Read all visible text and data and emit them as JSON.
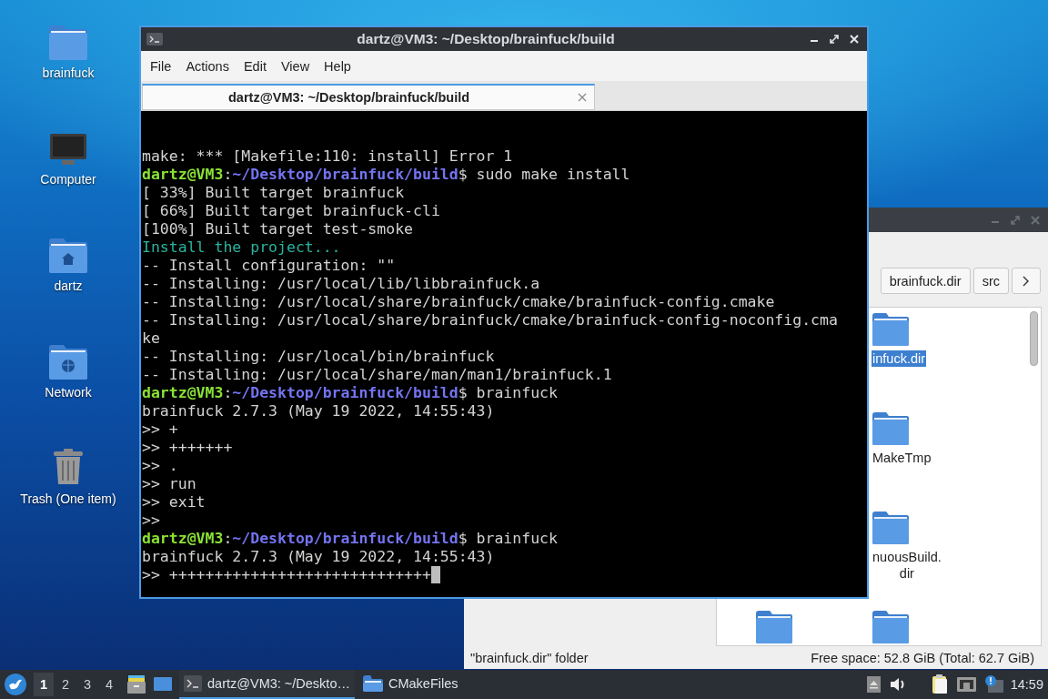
{
  "desktop_icons": [
    {
      "label": "brainfuck",
      "kind": "folder"
    },
    {
      "label": "Computer",
      "kind": "computer"
    },
    {
      "label": "dartz",
      "kind": "home"
    },
    {
      "label": "Network",
      "kind": "network"
    },
    {
      "label": "Trash (One item)",
      "kind": "trash"
    }
  ],
  "file_manager": {
    "breadcrumbs": [
      "brainfuck.dir",
      "src"
    ],
    "files": [
      {
        "label": "infuck.dir",
        "selected": true
      },
      {
        "label": "MakeTmp",
        "selected": false
      },
      {
        "label": "nuousBuild.\ndir",
        "selected": false
      },
      {
        "selected": false
      },
      {
        "selected": false
      }
    ],
    "status_bar": {
      "selection": "\"brainfuck.dir\" folder",
      "free_space": "Free space: 52.8 GiB (Total: 62.7 GiB)"
    }
  },
  "terminal": {
    "title": "dartz@VM3: ~/Desktop/brainfuck/build",
    "menu": [
      "File",
      "Actions",
      "Edit",
      "View",
      "Help"
    ],
    "tabs": [
      {
        "label": "dartz@VM3: ~/Desktop/brainfuck/build",
        "selected": true
      }
    ],
    "cursor": true,
    "lines": [
      [
        {
          "kind": "plain",
          "text": "make: *** [Makefile:110: install] Error 1"
        }
      ],
      [
        {
          "kind": "user",
          "text": "dartz@VM3"
        },
        {
          "kind": "plain",
          "text": ":"
        },
        {
          "kind": "path",
          "text": "~/Desktop/brainfuck/build"
        },
        {
          "kind": "plain",
          "text": "$ sudo make install"
        }
      ],
      [
        {
          "kind": "plain",
          "text": "[ 33%] Built target brainfuck"
        }
      ],
      [
        {
          "kind": "plain",
          "text": "[ 66%] Built target brainfuck-cli"
        }
      ],
      [
        {
          "kind": "plain",
          "text": "[100%] Built target test-smoke"
        }
      ],
      [
        {
          "kind": "info",
          "text": "Install the project..."
        }
      ],
      [
        {
          "kind": "plain",
          "text": "-- Install configuration: \"\""
        }
      ],
      [
        {
          "kind": "plain",
          "text": "-- Installing: /usr/local/lib/libbrainfuck.a"
        }
      ],
      [
        {
          "kind": "plain",
          "text": "-- Installing: /usr/local/share/brainfuck/cmake/brainfuck-config.cmake"
        }
      ],
      [
        {
          "kind": "plain",
          "text": "-- Installing: /usr/local/share/brainfuck/cmake/brainfuck-config-noconfig.cma"
        }
      ],
      [
        {
          "kind": "plain",
          "text": "ke"
        }
      ],
      [
        {
          "kind": "plain",
          "text": "-- Installing: /usr/local/bin/brainfuck"
        }
      ],
      [
        {
          "kind": "plain",
          "text": "-- Installing: /usr/local/share/man/man1/brainfuck.1"
        }
      ],
      [
        {
          "kind": "user",
          "text": "dartz@VM3"
        },
        {
          "kind": "plain",
          "text": ":"
        },
        {
          "kind": "path",
          "text": "~/Desktop/brainfuck/build"
        },
        {
          "kind": "plain",
          "text": "$ brainfuck"
        }
      ],
      [
        {
          "kind": "plain",
          "text": "brainfuck 2.7.3 (May 19 2022, 14:55:43)"
        }
      ],
      [
        {
          "kind": "plain",
          "text": ">> +"
        }
      ],
      [
        {
          "kind": "plain",
          "text": ">> +++++++"
        }
      ],
      [
        {
          "kind": "plain",
          "text": ">> ."
        }
      ],
      [
        {
          "kind": "plain",
          "text": ">> run"
        }
      ],
      [
        {
          "kind": "plain",
          "text": ">> exit"
        }
      ],
      [
        {
          "kind": "plain",
          "text": ">>"
        }
      ],
      [
        {
          "kind": "user",
          "text": "dartz@VM3"
        },
        {
          "kind": "plain",
          "text": ":"
        },
        {
          "kind": "path",
          "text": "~/Desktop/brainfuck/build"
        },
        {
          "kind": "plain",
          "text": "$ brainfuck"
        }
      ],
      [
        {
          "kind": "plain",
          "text": "brainfuck 2.7.3 (May 19 2022, 14:55:43)"
        }
      ],
      [
        {
          "kind": "plain",
          "text": ">> +++++++++++++++++++++++++++++"
        }
      ]
    ]
  },
  "taskbar": {
    "workspaces": [
      {
        "label": "1",
        "selected": true
      },
      {
        "label": "2",
        "selected": false
      },
      {
        "label": "3",
        "selected": false
      },
      {
        "label": "4",
        "selected": false
      }
    ],
    "tasks": [
      {
        "kind": "terminal",
        "label": "dartz@VM3: ~/Deskto…",
        "selected": true
      },
      {
        "kind": "folder",
        "label": "CMakeFiles",
        "selected": false
      }
    ],
    "clock": "14:59"
  }
}
